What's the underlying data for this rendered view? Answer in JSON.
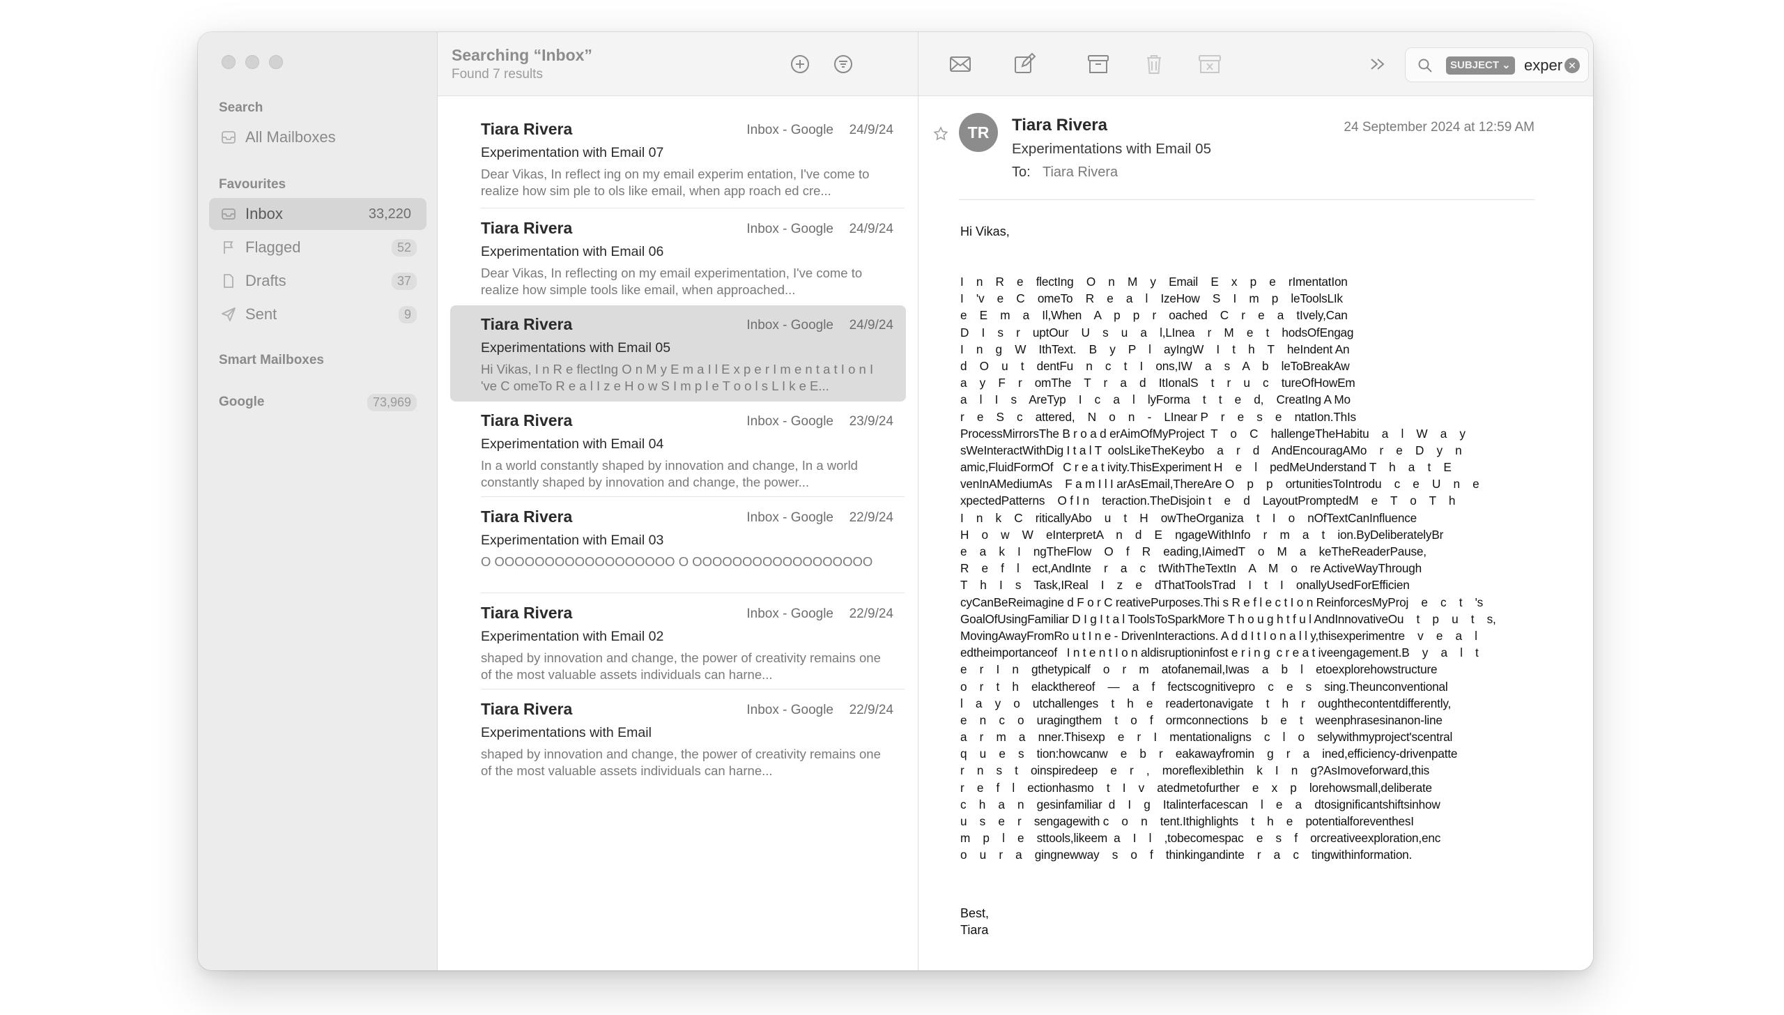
{
  "sidebar": {
    "section_search": "Search",
    "all_mailboxes": "All Mailboxes",
    "section_favourites": "Favourites",
    "items": [
      {
        "label": "Inbox",
        "count": "33,220"
      },
      {
        "label": "Flagged",
        "count": "52"
      },
      {
        "label": "Drafts",
        "count": "37"
      },
      {
        "label": "Sent",
        "count": "9"
      }
    ],
    "section_smart": "Smart Mailboxes",
    "account": {
      "label": "Google",
      "count": "73,969"
    }
  },
  "list": {
    "title": "Searching “Inbox”",
    "subtitle": "Found 7 results",
    "messages": [
      {
        "sender": "Tiara Rivera",
        "mailbox": "Inbox - Google",
        "date": "24/9/24",
        "subject": "Experimentation with Email 07",
        "preview": "Dear Vikas, In reflect ing on my email experim entation, I've come to realize how sim ple to ols like email, when app roach ed cre..."
      },
      {
        "sender": "Tiara Rivera",
        "mailbox": "Inbox - Google",
        "date": "24/9/24",
        "subject": "Experimentation with Email 06",
        "preview": "Dear Vikas, In reflecting on my email experimentation, I've come to realize how simple tools like email, when approached..."
      },
      {
        "sender": "Tiara Rivera",
        "mailbox": "Inbox - Google",
        "date": "24/9/24",
        "subject": "Experimentations with Email 05",
        "preview": "Hi Vikas, I n R e flectIng O n M y E m a I l E x p e r I m e n t a t I o n I 've C omeTo R e a l I z e H o w S I m p l e T o o l s L I k e E..."
      },
      {
        "sender": "Tiara Rivera",
        "mailbox": "Inbox - Google",
        "date": "23/9/24",
        "subject": "Experimentation with Email 04",
        "preview": "In a world constantly shaped by innovation and change, In a world constantly shaped by innovation and change, the power..."
      },
      {
        "sender": "Tiara Rivera",
        "mailbox": "Inbox - Google",
        "date": "22/9/24",
        "subject": "Experimentation with Email 03",
        "preview": "O OOOOOOOOOOOOOOOOOO O OOOOOOOOOOOOOOOOOO"
      },
      {
        "sender": "Tiara Rivera",
        "mailbox": "Inbox - Google",
        "date": "22/9/24",
        "subject": "Experimentation with Email 02",
        "preview": "shaped by innovation and change, the power of creativity remains one of the most valuable assets individuals can harne..."
      },
      {
        "sender": "Tiara Rivera",
        "mailbox": "Inbox - Google",
        "date": "22/9/24",
        "subject": "Experimentations with Email",
        "preview": "shaped by innovation and change, the power of creativity remains one of the most valuable assets individuals can harne..."
      }
    ]
  },
  "search": {
    "token": "SUBJECT ⌄",
    "text": "exper"
  },
  "reader": {
    "initials": "TR",
    "sender": "Tiara Rivera",
    "subject": "Experimentations with Email 05",
    "to_label": "To:",
    "to": "Tiara Rivera",
    "date": "24 September 2024 at 12:59 AM",
    "greeting": "Hi Vikas,",
    "body_lines": [
      "I    n    R    e    flectIng    O    n    M    y    Email    E    x    p    e    rImentatIon",
      "I    'v    e    C    omeTo    R    e    a    l    IzeHow    S    I    m    p    leToolsLIk",
      "e    E    m    a    Il,When    A    p    p    r    oached    C    r    e    a    tIvely,Can",
      "D    I    s    r    uptOur    U    s    u    a    l,LInea    r    M    e    t    hodsOfEngag",
      "I    n    g    W    IthText.    B    y    P    l    ayIngW    I    t    h    T    heIndent An",
      "d    O    u    t    dentFu    n    c    t    I    ons,IW    a    s    A    b    leToBreakAw",
      "a    y    F    r    omThe    T    r    a    d    ItIonalS    t    r    u    c    tureOfHowEm",
      "a    l    I    s    AreTyp    I    c    a    l    lyForma    t    t    e    d,    CreatIng A Mo",
      "r    e    S    c    attered,    N    o    n    -    LInear P    r    e    s    e    ntatIon.ThIs",
      "ProcessMirrorsThe B r o a d erAimOfMyProject  T    o    C    hallengeTheHabitu    a    l    W    a    y",
      "sWeInteractWithDig I t a l T  oolsLikeTheKeybo    a    r    d    AndEncouragAMo    r    e    D    y    n",
      "amic,FluidFormOf   C r e a t ivity.ThisExperiment H    e    l    pedMeUnderstand T    h    a    t    E",
      "venInAMediumAs    F a m I l I arAsEmail,ThereAre O    p    p    ortunitiesToIntrodu    c    e    U    n    e",
      "xpectedPatterns    O f I n    teraction.TheDisjoin t    e    d    LayoutPromptedM    e    T    o    T    h",
      "I    n    k    C    riticallyAbo    u    t    H    owTheOrganiza    t    I    o    nOfTextCanInfluence",
      "H    o    w    W    eInterpretA    n    d    E    ngageWithInfo    r    m    a    t    ion.ByDeliberatelyBr",
      "e    a    k    I    ngTheFlow    O    f    R    eading,IAimedT    o    M    a    keTheReaderPause,",
      "R    e    f    l    ect,AndInte    r    a    c    tWithTheTextIn    A    M    o    re ActiveWayThrough",
      "T    h    I    s    Task,IReal    I    z    e    dThatToolsTrad    I    t    I    onallyUsedForEfficien",
      "cyCanBeReimagine d F o r C reativePurposes.Thi s R e f l e c t I o n ReinforcesMyProj    e    c    t    's",
      "GoalOfUsingFamiliar D I g I t a l ToolsToSparkMore T h o u g h t f u l AndInnovativeOu    t    p    u    t    s,",
      "MovingAwayFromRo u t I n e - DrivenInteractions. A d d I t I o n a l l y,thisexperimentre    v    e    a    l",
      "edtheimportanceof   I n t e n t I o n aldisruptioninfost e r i n g  c r e a t iveengagement.B    y    a    l    t",
      "e    r    I    n    gthetypicalf    o    r    m    atofanemail,Iwas    a    b    l    etoexplorehowstructure",
      "o    r    t    h    elackthereof    —    a    f    fectscognitivepro    c    e    s    sing.Theunconventional",
      "l    a    y    o    utchallenges    t    h    e    readertonavigate    t    h    r    oughthecontentdifferently,",
      "e    n    c    o    uragingthem    t    o    f    ormconnections    b    e    t    weenphrasesinanon-line",
      "a    r    m    a    nner.Thisexp    e    r    I    mentationaligns    c    l    o    selywithmyproject'scentral",
      "q    u    e    s    tion:howcanw    e    b    r    eakawayfromin    g    r    a    ined,efficiency-drivenpatte",
      "r    n    s    t    oinspiredeep    e    r    ,    moreflexiblethin    k    I    n    g?AsImoveforward,this",
      "r    e    f    l    ectionhasmo    t    I    v    atedmetofurther    e    x    p    lorehowsmall,deliberate",
      "c    h    a    n    gesinfamiliar  d    I    g    Italinterfacescan    l    e    a    dtosignificantshiftsinhow",
      "u    s    e    r    sengagewith c    o    n    tent.Ithighlights    t    h    e    potentialforeventhesI",
      "m    p    l    e    sttools,likeem  a    I    l    ,tobecomespac    e    s    f    orcreativeexploration,enc",
      "o    u    r    a    gingnewway    s    o    f    thinkingandinte    r    a    c    tingwithinformation."
    ],
    "signoff_1": "Best,",
    "signoff_2": "Tiara"
  },
  "icons": {
    "traffic_lights": [
      "close-icon",
      "minimize-icon",
      "zoom-icon"
    ],
    "toolbar": [
      "new-message-icon",
      "compose-icon",
      "archive-icon",
      "trash-icon",
      "junk-icon",
      "more-icon",
      "search-icon"
    ]
  },
  "colors": {
    "sidebar_bg": "#ececec",
    "selected_row": "#dcdcdc",
    "avatar_bg": "#8c8c8c",
    "search_token_bg": "#8e8e8e"
  }
}
